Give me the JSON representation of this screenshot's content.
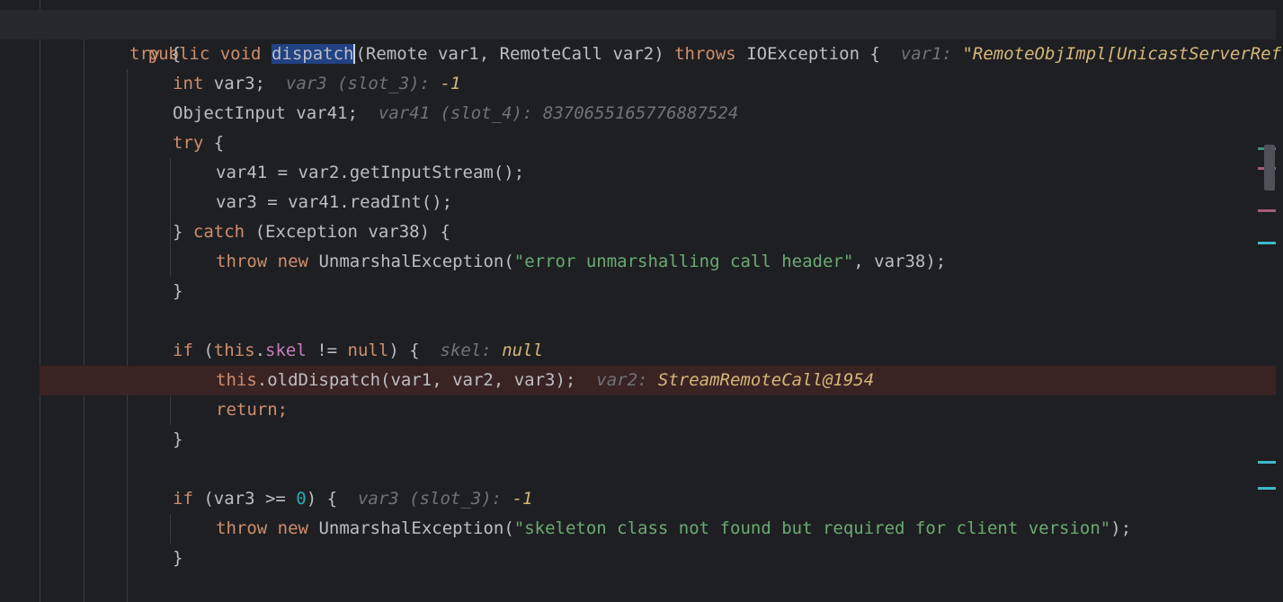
{
  "editor": {
    "lines": [
      {
        "sig_public": "public",
        "sig_void": "void",
        "sig_name": "dispatch",
        "sig_params": "(Remote var1, RemoteCall var2)",
        "sig_throws": "throws",
        "sig_exc": "IOException {",
        "hint_label": "var1:",
        "hint_value": "\"RemoteObjImpl[UnicastServerRef"
      },
      {
        "try_kw": "try",
        "brace": "{"
      },
      {
        "type": "int",
        "rest": "var3;",
        "hint_label": "var3 (slot_3):",
        "hint_value": "-1"
      },
      {
        "type": "ObjectInput",
        "rest": "var41;",
        "hint_label": "var41 (slot_4):",
        "hint_value": "8370655165776887524"
      },
      {
        "try_kw": "try",
        "brace": "{"
      },
      {
        "code": "var41 = var2.getInputStream();"
      },
      {
        "code": "var3 = var41.readInt();"
      },
      {
        "close": "}",
        "catch_kw": "catch",
        "rest": "(Exception var38) {"
      },
      {
        "throw_kw": "throw",
        "new_kw": "new",
        "cls": "UnmarshalException(",
        "str": "\"error unmarshalling call header\"",
        "rest": ", var38);"
      },
      {
        "close": "}"
      },
      {
        "if_kw": "if",
        "paren": "(",
        "this_kw": "this",
        "dot": ".",
        "field": "skel",
        "op": " != ",
        "null_kw": "null",
        "rest": ") {",
        "hint_label": "skel:",
        "hint_value": "null"
      },
      {
        "this_kw": "this",
        "rest": ".oldDispatch(var1, var2, var3);",
        "hint_label": "var2:",
        "hint_value": "StreamRemoteCall@1954"
      },
      {
        "code": "return;"
      },
      {
        "close": "}"
      },
      {
        "if_kw": "if",
        "pre": "(var3 >= ",
        "num": "0",
        "rest": ") {",
        "hint_label": "var3 (slot_3):",
        "hint_value": "-1"
      },
      {
        "throw_kw": "throw",
        "new_kw": "new",
        "cls": "UnmarshalException(",
        "str": "\"skeleton class not found but required for client version\"",
        "rest": ");"
      },
      {
        "close": "}"
      }
    ]
  },
  "colors": {
    "background": "#1e1f22",
    "keyword": "#cf8e6d",
    "string": "#6aab73",
    "number": "#2aacb8",
    "field": "#c77dbb",
    "hint_name": "#6f737a",
    "hint_value": "#d5b778",
    "breakpoint_line": "#3a2323",
    "selection": "#214283"
  },
  "scrollbar_marks": [
    "#3d8f7a",
    "#a25e73",
    "#a25e73",
    "#3fb8c9",
    "#3fb8c9",
    "#3fb8c9"
  ]
}
